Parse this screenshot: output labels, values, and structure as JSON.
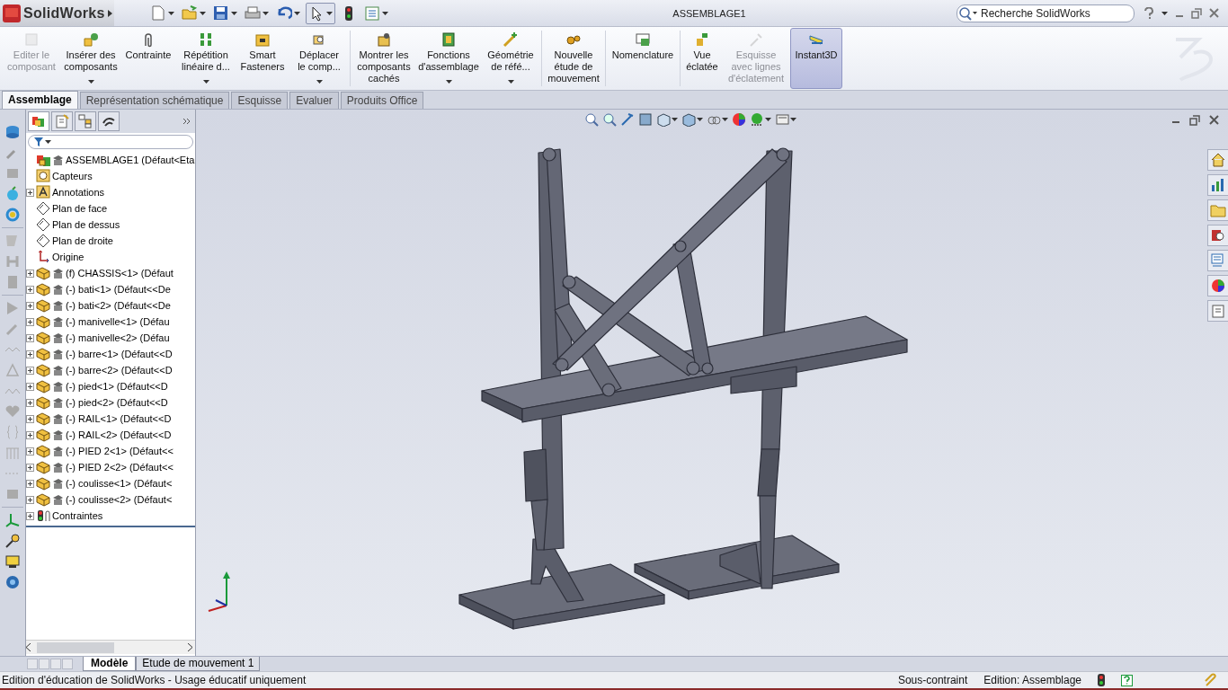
{
  "app": {
    "name": "SolidWorks"
  },
  "window": {
    "title": "ASSEMBLAGE1"
  },
  "search": {
    "placeholder": "Recherche SolidWorks"
  },
  "ribbon": [
    {
      "label": "Editer le\ncomposant",
      "disabled": true,
      "selected": false,
      "menu": false
    },
    {
      "label": "Insérer des\ncomposants",
      "disabled": false,
      "selected": false,
      "menu": true
    },
    {
      "label": "Contrainte",
      "disabled": false,
      "selected": false,
      "menu": false
    },
    {
      "label": "Répétition\nlinéaire d...",
      "disabled": false,
      "selected": false,
      "menu": true
    },
    {
      "label": "Smart\nFasteners",
      "disabled": false,
      "selected": false,
      "menu": false
    },
    {
      "label": "Déplacer\nle comp...",
      "disabled": false,
      "selected": false,
      "menu": true
    },
    {
      "label": "Montrer les\ncomposants\ncachés",
      "disabled": false,
      "selected": false,
      "menu": false
    },
    {
      "label": "Fonctions\nd'assemblage",
      "disabled": false,
      "selected": false,
      "menu": true
    },
    {
      "label": "Géométrie\nde réfé...",
      "disabled": false,
      "selected": false,
      "menu": true
    },
    {
      "label": "Nouvelle\nétude de\nmouvement",
      "disabled": false,
      "selected": false,
      "menu": false
    },
    {
      "label": "Nomenclature",
      "disabled": false,
      "selected": false,
      "menu": false
    },
    {
      "label": "Vue\néclatée",
      "disabled": false,
      "selected": false,
      "menu": false
    },
    {
      "label": "Esquisse\navec lignes\nd'éclatement",
      "disabled": true,
      "selected": false,
      "menu": false
    },
    {
      "label": "Instant3D",
      "disabled": false,
      "selected": true,
      "menu": false
    }
  ],
  "tabs": [
    {
      "label": "Assemblage",
      "selected": true
    },
    {
      "label": "Représentation schématique",
      "selected": false
    },
    {
      "label": "Esquisse",
      "selected": false
    },
    {
      "label": "Evaluer",
      "selected": false
    },
    {
      "label": "Produits Office",
      "selected": false
    }
  ],
  "feature_tree": {
    "items": [
      {
        "label": "ASSEMBLAGE1  (Défaut<Eta",
        "kind": "assembly",
        "expandable": false,
        "children": [
          {
            "label": "Capteurs",
            "kind": "sensors",
            "expandable": false
          },
          {
            "label": "Annotations",
            "kind": "annotations",
            "expandable": true
          },
          {
            "label": "Plan de face",
            "kind": "plane",
            "expandable": false
          },
          {
            "label": "Plan de dessus",
            "kind": "plane",
            "expandable": false
          },
          {
            "label": "Plan de droite",
            "kind": "plane",
            "expandable": false
          },
          {
            "label": "Origine",
            "kind": "origin",
            "expandable": false
          },
          {
            "label": "(f) CHASSIS<1> (Défaut",
            "kind": "part",
            "expandable": true
          },
          {
            "label": "(-) bati<1> (Défaut<<De",
            "kind": "part",
            "expandable": true
          },
          {
            "label": "(-) bati<2> (Défaut<<De",
            "kind": "part",
            "expandable": true
          },
          {
            "label": "(-) manivelle<1> (Défau",
            "kind": "part",
            "expandable": true
          },
          {
            "label": "(-) manivelle<2> (Défau",
            "kind": "part",
            "expandable": true
          },
          {
            "label": "(-) barre<1> (Défaut<<D",
            "kind": "part",
            "expandable": true
          },
          {
            "label": "(-) barre<2> (Défaut<<D",
            "kind": "part",
            "expandable": true
          },
          {
            "label": "(-) pied<1> (Défaut<<D",
            "kind": "part",
            "expandable": true
          },
          {
            "label": "(-) pied<2> (Défaut<<D",
            "kind": "part",
            "expandable": true
          },
          {
            "label": "(-) RAIL<1> (Défaut<<D",
            "kind": "part",
            "expandable": true
          },
          {
            "label": "(-) RAIL<2> (Défaut<<D",
            "kind": "part",
            "expandable": true
          },
          {
            "label": "(-) PIED 2<1> (Défaut<<",
            "kind": "part",
            "expandable": true
          },
          {
            "label": "(-) PIED 2<2> (Défaut<<",
            "kind": "part",
            "expandable": true
          },
          {
            "label": "(-) coulisse<1> (Défaut<",
            "kind": "part",
            "expandable": true
          },
          {
            "label": "(-) coulisse<2> (Défaut<",
            "kind": "part",
            "expandable": true
          },
          {
            "label": "Contraintes",
            "kind": "mates",
            "expandable": true
          }
        ]
      }
    ]
  },
  "bottom_tabs": [
    {
      "label": "Modèle",
      "selected": true
    },
    {
      "label": "Etude de mouvement 1",
      "selected": false
    }
  ],
  "status_bar": {
    "message": "Edition d'éducation de SolidWorks - Usage éducatif uniquement",
    "constraint": "Sous-contraint",
    "mode": "Edition: Assemblage"
  }
}
